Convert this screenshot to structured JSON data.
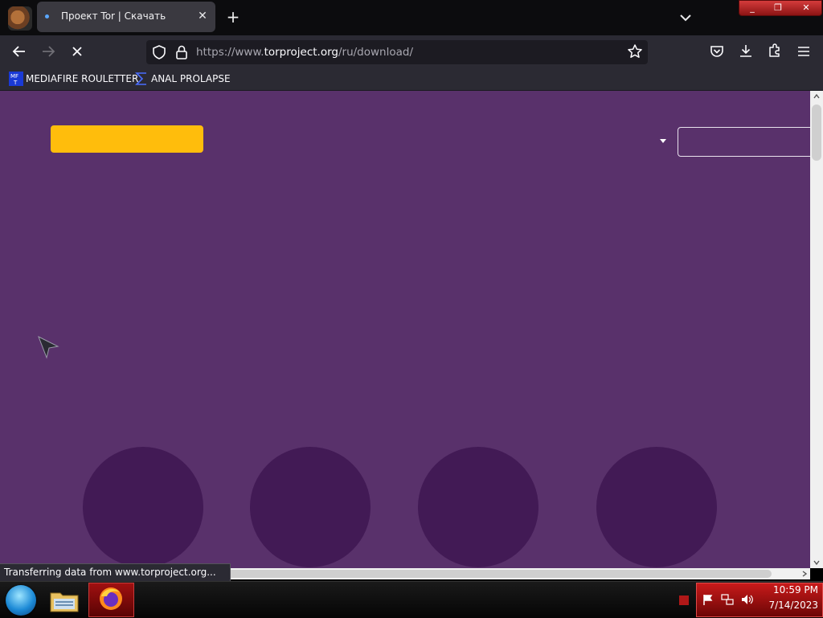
{
  "window": {
    "minimize_glyph": "_",
    "restore_glyph": "❐",
    "close_glyph": "✕"
  },
  "tabs": [
    {
      "title": "Проект Tor | Скачать",
      "active": true,
      "close_glyph": "✕"
    }
  ],
  "tabstrip": {
    "new_tab_glyph": "+"
  },
  "navigation": {
    "url_prefix": "https://www.",
    "url_domain": "torproject.org",
    "url_path": "/ru/download/"
  },
  "bookmarks": [
    {
      "label": "MEDIAFIRE ROULETTER",
      "icon": "mft-icon"
    },
    {
      "label": "ANAL PROLAPSE",
      "icon": "sigma-icon"
    }
  ],
  "status_bar": {
    "text": "Transferring data from www.torproject.org..."
  },
  "taskbar": {
    "time": "10:59 PM",
    "date": "7/14/2023"
  },
  "colors": {
    "page_bg": "#59316b",
    "accent_button": "#ffbd0c",
    "circle": "#421a55"
  }
}
